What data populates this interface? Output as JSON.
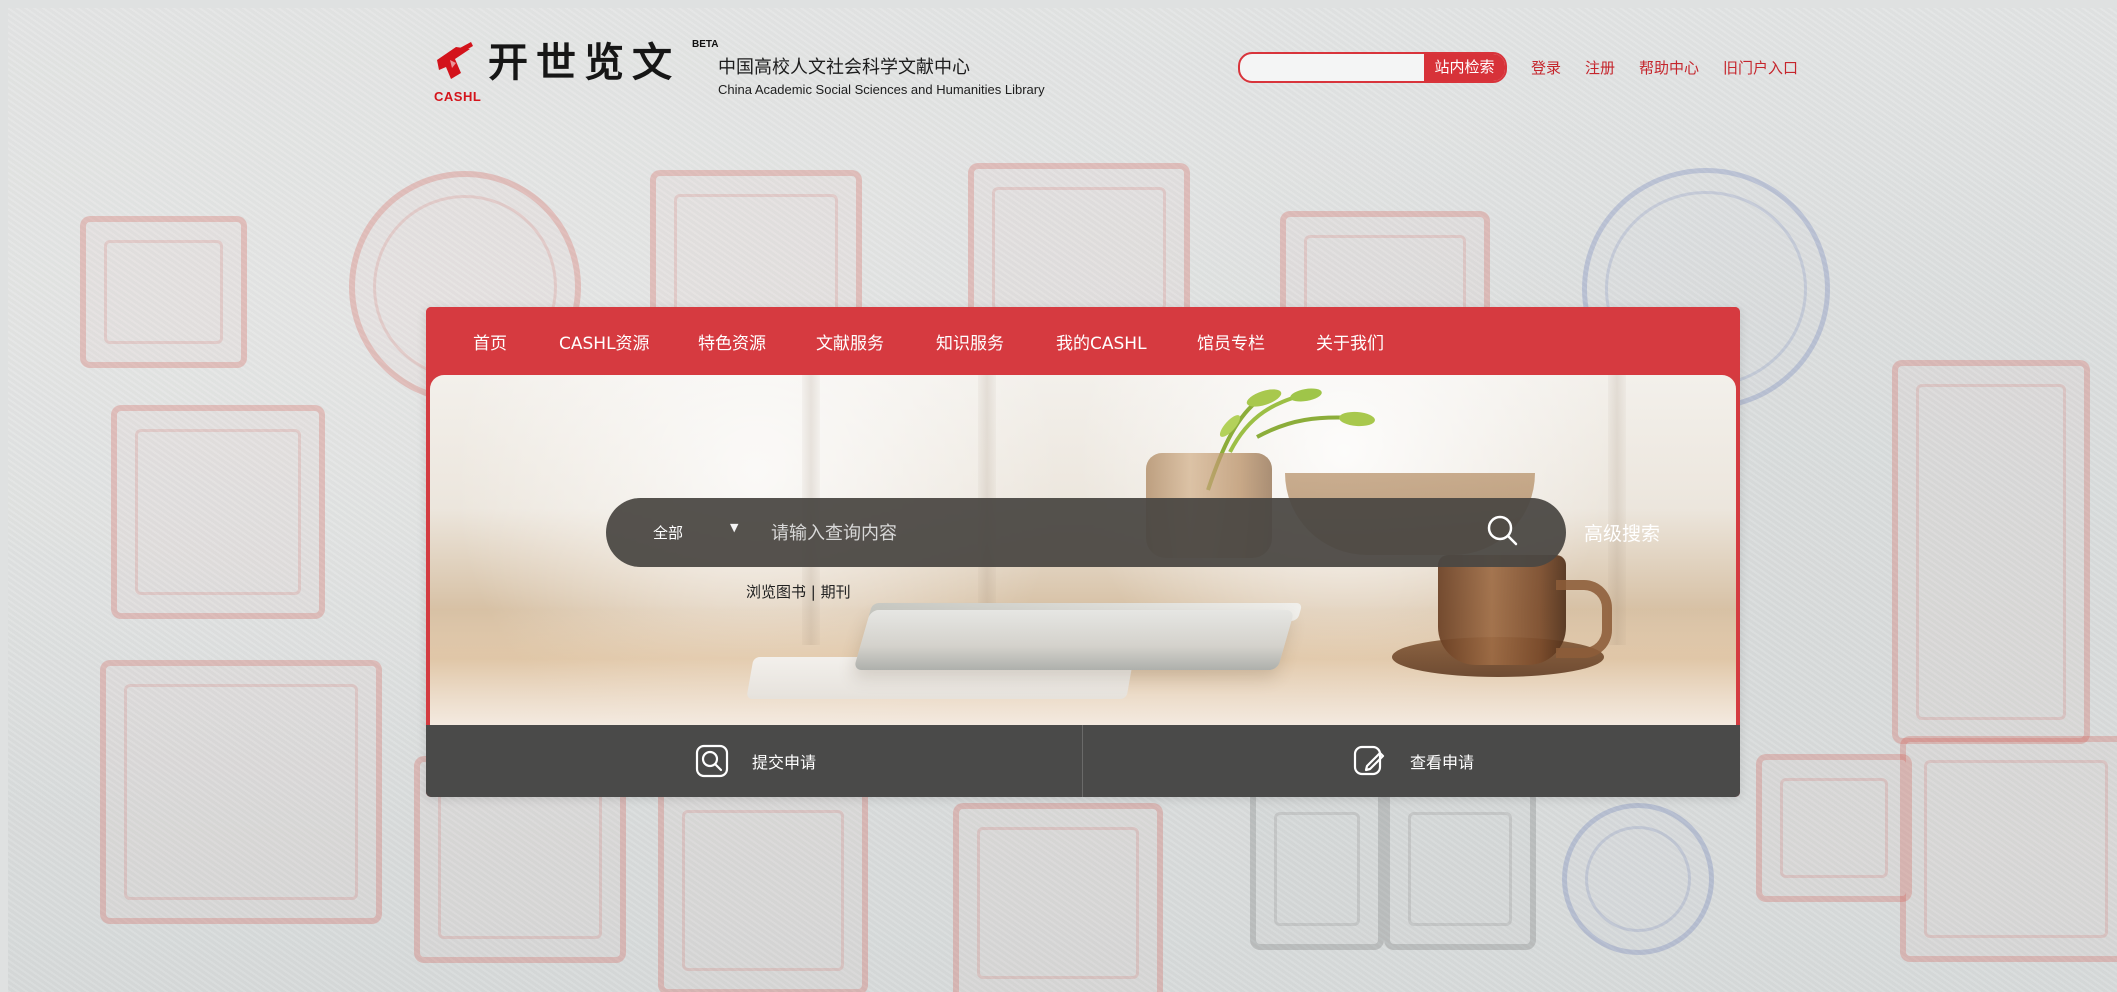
{
  "header": {
    "logo_small": "CASHL",
    "logo_chinese": "开世览文",
    "beta": "BETA",
    "subtitle": "中国高校人文社会科学文献中心",
    "english_name": "China Academic Social Sciences and Humanities Library",
    "search_button": "站内检索",
    "links": [
      "登录",
      "注册",
      "帮助中心",
      "旧门户入口"
    ]
  },
  "nav": {
    "items": [
      "首页",
      "CASHL资源",
      "特色资源",
      "文献服务",
      "知识服务",
      "我的CASHL",
      "馆员专栏",
      "关于我们"
    ]
  },
  "search": {
    "category": "全部",
    "placeholder": "请输入查询内容",
    "advanced": "高级搜索",
    "browse_books": "浏览图书",
    "browse_sep": "|",
    "browse_journals": "期刊"
  },
  "actions": {
    "submit": "提交申请",
    "view": "查看申请"
  },
  "colors": {
    "brand_red": "#d63a40",
    "dark_bar": "#4a4a49"
  }
}
